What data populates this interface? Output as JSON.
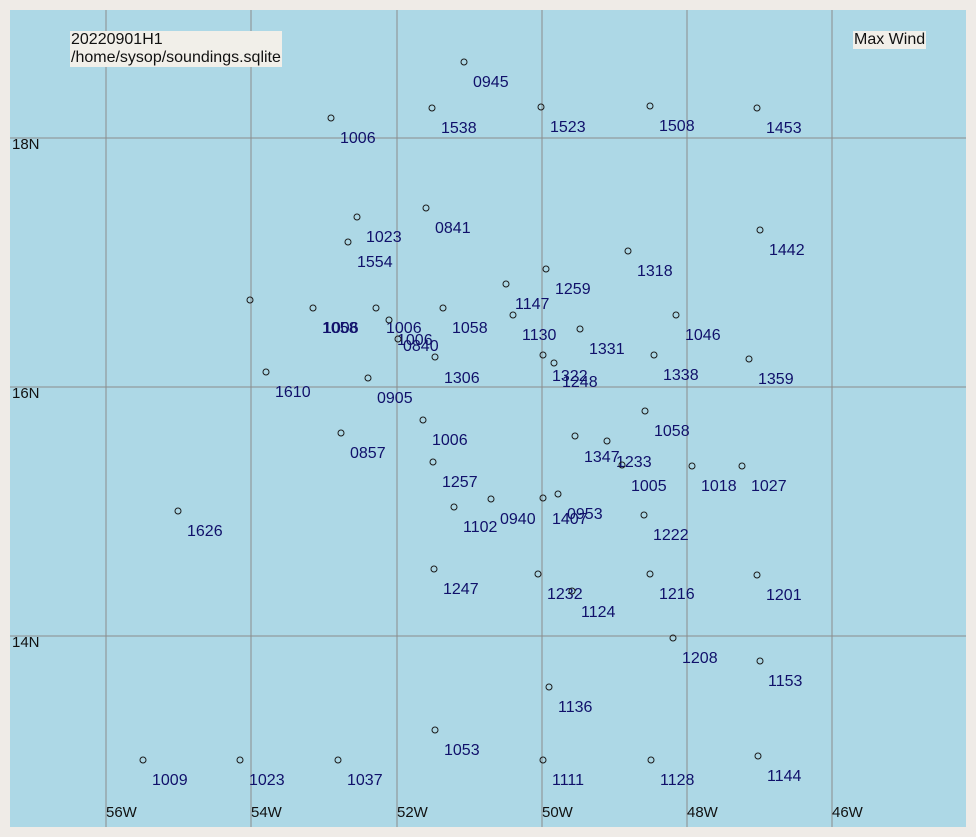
{
  "header": {
    "dataset": "20220901H1",
    "database_path": "/home/sysop/soundings.sqlite",
    "field": "Max Wind"
  },
  "colors": {
    "background": "#add8e6",
    "frame": "#efebe7",
    "gridline": "#8c8c8c",
    "station_label": "#10106a",
    "marker": "#1a1a1a"
  },
  "map": {
    "longitude_labels": [
      "56W",
      "54W",
      "52W",
      "50W",
      "48W",
      "46W"
    ],
    "latitude_labels": [
      "18N",
      "16N",
      "14N"
    ],
    "stations": [
      {
        "label": "0945"
      },
      {
        "label": "1006"
      },
      {
        "label": "1538"
      },
      {
        "label": "1523"
      },
      {
        "label": "1508"
      },
      {
        "label": "1453"
      },
      {
        "label": "1023"
      },
      {
        "label": "0841"
      },
      {
        "label": "1554"
      },
      {
        "label": "1442"
      },
      {
        "label": "1318"
      },
      {
        "label": "1259"
      },
      {
        "label": "1147"
      },
      {
        "label": "1058"
      },
      {
        "label": "1006"
      },
      {
        "label": "1006"
      },
      {
        "label": "1006"
      },
      {
        "label": "0840"
      },
      {
        "label": "1058"
      },
      {
        "label": "1130"
      },
      {
        "label": "1331"
      },
      {
        "label": "1046"
      },
      {
        "label": "1306"
      },
      {
        "label": "1322"
      },
      {
        "label": "1248"
      },
      {
        "label": "1338"
      },
      {
        "label": "1359"
      },
      {
        "label": "1610"
      },
      {
        "label": "0905"
      },
      {
        "label": "1006"
      },
      {
        "label": "1058"
      },
      {
        "label": "0857"
      },
      {
        "label": "1347"
      },
      {
        "label": "1233"
      },
      {
        "label": "1257"
      },
      {
        "label": "1005"
      },
      {
        "label": "1018"
      },
      {
        "label": "1027"
      },
      {
        "label": "1102"
      },
      {
        "label": "0940"
      },
      {
        "label": "1407"
      },
      {
        "label": "0953"
      },
      {
        "label": "1222"
      },
      {
        "label": "1626"
      },
      {
        "label": "1247"
      },
      {
        "label": "1232"
      },
      {
        "label": "1124"
      },
      {
        "label": "1216"
      },
      {
        "label": "1201"
      },
      {
        "label": "1208"
      },
      {
        "label": "1153"
      },
      {
        "label": "1136"
      },
      {
        "label": "1053"
      },
      {
        "label": "1009"
      },
      {
        "label": "1023"
      },
      {
        "label": "1037"
      },
      {
        "label": "1111"
      },
      {
        "label": "1128"
      },
      {
        "label": "1144"
      }
    ]
  }
}
